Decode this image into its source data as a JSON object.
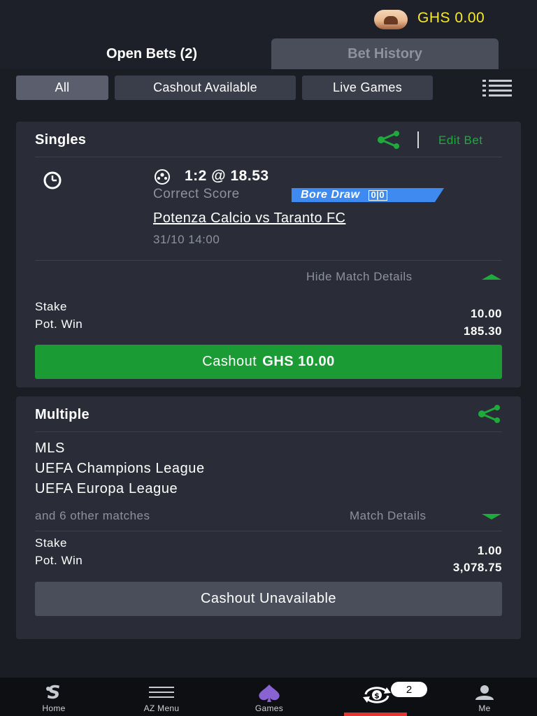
{
  "header": {
    "balance": "GHS 0.00",
    "avatar_icon": "profile-photo"
  },
  "tabs": {
    "open_bets": "Open Bets (2)",
    "bet_history": "Bet History"
  },
  "filters": {
    "all": "All",
    "cashout_available": "Cashout Available",
    "live_games": "Live Games",
    "selected": "All"
  },
  "singles": {
    "title": "Singles",
    "edit_bet": "Edit Bet",
    "pick": "1:2 @ 18.53",
    "market": "Correct Score",
    "badge_label": "Bore Draw",
    "badge_score": "0|0",
    "match": "Potenza Calcio vs Taranto FC",
    "datetime": "31/10 14:00",
    "toggle": "Hide Match Details",
    "stake_label": "Stake",
    "stake_value": "10.00",
    "potwin_label": "Pot. Win",
    "potwin_value": "185.30",
    "cashout_prefix": "Cashout",
    "cashout_amount": "GHS 10.00"
  },
  "multiple": {
    "title": "Multiple",
    "leagues": [
      "MLS",
      "UEFA Champions League",
      "UEFA Europa League"
    ],
    "others": "and 6 other matches",
    "toggle": "Match Details",
    "stake_label": "Stake",
    "stake_value": "1.00",
    "potwin_label": "Pot. Win",
    "potwin_value": "3,078.75",
    "cashout": "Cashout Unavailable"
  },
  "nav": {
    "home": "Home",
    "az_menu": "AZ Menu",
    "games": "Games",
    "open_bets_count": "2",
    "me": "Me"
  },
  "colors": {
    "background": "#1e2029",
    "card": "#2a2c37",
    "accent_green": "#1faa3c",
    "balance_yellow": "#f7ea2c",
    "badge_blue": "#3f8af0",
    "active_red": "#e3342f"
  }
}
